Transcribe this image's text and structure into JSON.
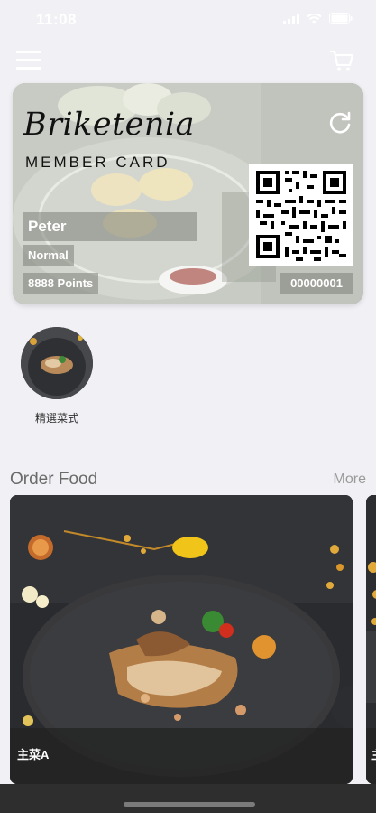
{
  "status_bar": {
    "time": "11:08"
  },
  "icons": {
    "menu": "hamburger-icon",
    "cart": "cart-icon",
    "refresh": "refresh-icon",
    "wifi": "wifi-icon",
    "battery": "battery-icon"
  },
  "member_card": {
    "brand": "Briketenia",
    "subtitle": "MEMBER CARD",
    "name": "Peter",
    "tier": "Normal",
    "points": "8888 Points",
    "member_number": "00000001"
  },
  "featured": {
    "label": "精選菜式"
  },
  "order_food": {
    "title": "Order Food",
    "more": "More",
    "items": [
      {
        "name": "主菜A"
      },
      {
        "name": "主"
      }
    ]
  },
  "colors": {
    "background": "#f1f1f5",
    "card_tag": "#7d8278",
    "plate": "#3a3b3f",
    "caption_bg": "#232323"
  }
}
